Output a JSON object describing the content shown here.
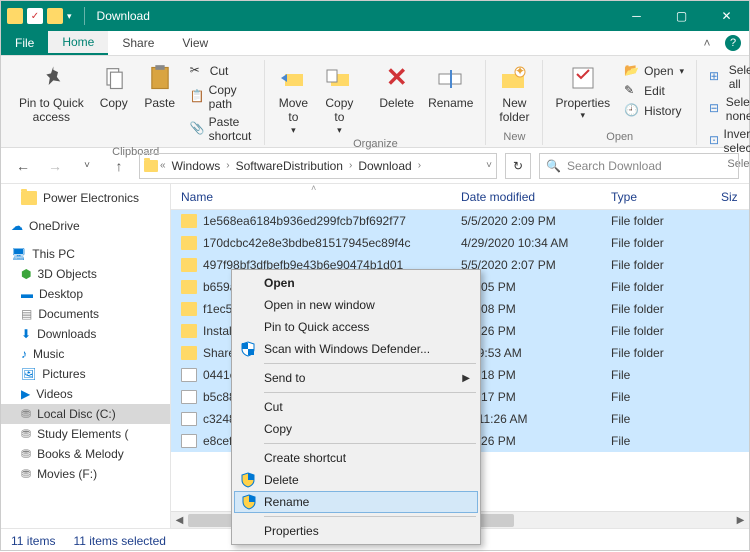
{
  "titlebar": {
    "title": "Download"
  },
  "menus": {
    "file": "File",
    "home": "Home",
    "share": "Share",
    "view": "View"
  },
  "ribbon": {
    "pin": "Pin to Quick\naccess",
    "copy": "Copy",
    "paste": "Paste",
    "cut": "Cut",
    "copypath": "Copy path",
    "pasteshort": "Paste shortcut",
    "moveto": "Move\nto",
    "copyto": "Copy\nto",
    "delete": "Delete",
    "rename": "Rename",
    "newfolder": "New\nfolder",
    "properties": "Properties",
    "open": "Open",
    "edit": "Edit",
    "history": "History",
    "selectall": "Select all",
    "selectnone": "Select none",
    "invert": "Invert selection",
    "g_clipboard": "Clipboard",
    "g_organize": "Organize",
    "g_new": "New",
    "g_open": "Open",
    "g_select": "Select"
  },
  "breadcrumb": {
    "items": [
      "Windows",
      "SoftwareDistribution",
      "Download"
    ]
  },
  "search": {
    "placeholder": "Search Download"
  },
  "nav": {
    "power": "Power Electronics",
    "onedrive": "OneDrive",
    "thispc": "This PC",
    "objects3d": "3D Objects",
    "desktop": "Desktop",
    "documents": "Documents",
    "downloads": "Downloads",
    "music": "Music",
    "pictures": "Pictures",
    "videos": "Videos",
    "localc": "Local Disc (C:)",
    "study": "Study Elements (",
    "books": "Books & Melody",
    "movies": "Movies (F:)"
  },
  "cols": {
    "name": "Name",
    "date": "Date modified",
    "type": "Type",
    "size": "Siz"
  },
  "files": [
    {
      "name": "1e568ea6184b936ed299fcb7bf692f77",
      "date": "5/5/2020 2:09 PM",
      "type": "File folder",
      "folder": true
    },
    {
      "name": "170dcbc42e8e3bdbe81517945ec89f4c",
      "date": "4/29/2020 10:34 AM",
      "type": "File folder",
      "folder": true
    },
    {
      "name": "497f98bf3dfbefb9e43b6e90474b1d01",
      "date": "5/5/2020 2:07 PM",
      "type": "File folder",
      "folder": true
    },
    {
      "name": "b659a9",
      "date": "0 2:05 PM",
      "type": "File folder",
      "folder": true
    },
    {
      "name": "f1ec50a",
      "date": "0 2:08 PM",
      "type": "File folder",
      "folder": true
    },
    {
      "name": "Install",
      "date": "0 1:26 PM",
      "type": "File folder",
      "folder": true
    },
    {
      "name": "SharedF",
      "date": "20 9:53 AM",
      "type": "File folder",
      "folder": true
    },
    {
      "name": "0441ef7",
      "date": "0 1:18 PM",
      "type": "File",
      "folder": false
    },
    {
      "name": "b5c885",
      "date": "0 1:17 PM",
      "type": "File",
      "folder": false
    },
    {
      "name": "c3248eb",
      "date": "20 11:26 AM",
      "type": "File",
      "folder": false
    },
    {
      "name": "e8cef3c",
      "date": "0 1:26 PM",
      "type": "File",
      "folder": false
    }
  ],
  "context": {
    "open": "Open",
    "opennew": "Open in new window",
    "pinquick": "Pin to Quick access",
    "defender": "Scan with Windows Defender...",
    "sendto": "Send to",
    "cut": "Cut",
    "copy": "Copy",
    "shortcut": "Create shortcut",
    "delete": "Delete",
    "rename": "Rename",
    "props": "Properties"
  },
  "status": {
    "count": "11 items",
    "selected": "11 items selected"
  }
}
